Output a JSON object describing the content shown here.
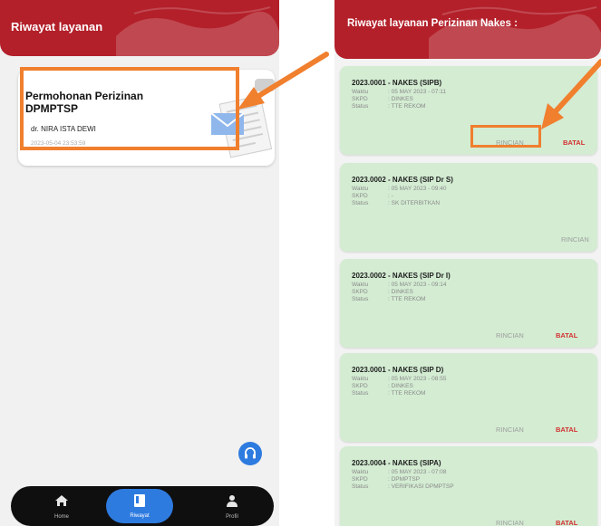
{
  "left_screen": {
    "header": {
      "title": "Riwayat layanan"
    },
    "service_card": {
      "title": "Permohonan Perizinan DPMPTSP",
      "name": "dr. NIRA ISTA DEWI",
      "date": "2023-05-04 23:53:59"
    },
    "bottom_nav": {
      "items": [
        {
          "label": "Home",
          "icon": "home-icon"
        },
        {
          "label": "Riwayat",
          "icon": "history-icon",
          "active": true
        },
        {
          "label": "Profil",
          "icon": "profile-icon"
        }
      ]
    },
    "fab": {
      "icon": "headset-icon"
    }
  },
  "right_screen": {
    "header": {
      "title": "Riwayat layanan Perizinan Nakes :"
    },
    "labels": {
      "waktu": "Waktu",
      "skpd": "SKPD",
      "status": "Status"
    },
    "cards": [
      {
        "title": "2023.0001 - NAKES (SIPB)",
        "waktu": ": 05 MAY 2023 - 07:11",
        "skpd": ": DINKES",
        "status": ": TTE REKOM",
        "rincian": "RINCIAN",
        "batal": "BATAL"
      },
      {
        "title": "2023.0002 - NAKES (SIP Dr S)",
        "waktu": ": 05 MAY 2023 - 09:40",
        "skpd": ": -",
        "status": ": SK DITERBITKAN",
        "rincian": "RINCIAN",
        "batal": ""
      },
      {
        "title": "2023.0002 - NAKES (SIP Dr I)",
        "waktu": ": 05 MAY 2023 - 09:14",
        "skpd": ": DINKES",
        "status": ": TTE REKOM",
        "rincian": "RINCIAN",
        "batal": "BATAL"
      },
      {
        "title": "2023.0001 - NAKES (SIP D)",
        "waktu": ": 05 MAY 2023 - 08:55",
        "skpd": ": DINKES",
        "status": ": TTE REKOM",
        "rincian": "RINCIAN",
        "batal": "BATAL"
      },
      {
        "title": "2023.0004 - NAKES (SIPA)",
        "waktu": ": 05 MAY 2023 - 07:08",
        "skpd": ": DPMPTSP",
        "status": ": VERIFIKASI DPMPTSP",
        "rincian": "RINCIAN",
        "batal": "BATAL"
      }
    ]
  },
  "colors": {
    "header_red": "#b3202a",
    "card_green": "#d3ecd2",
    "accent_blue": "#2e7be0",
    "highlight_orange": "#f07f2e",
    "batal_red": "#d32f2f"
  }
}
